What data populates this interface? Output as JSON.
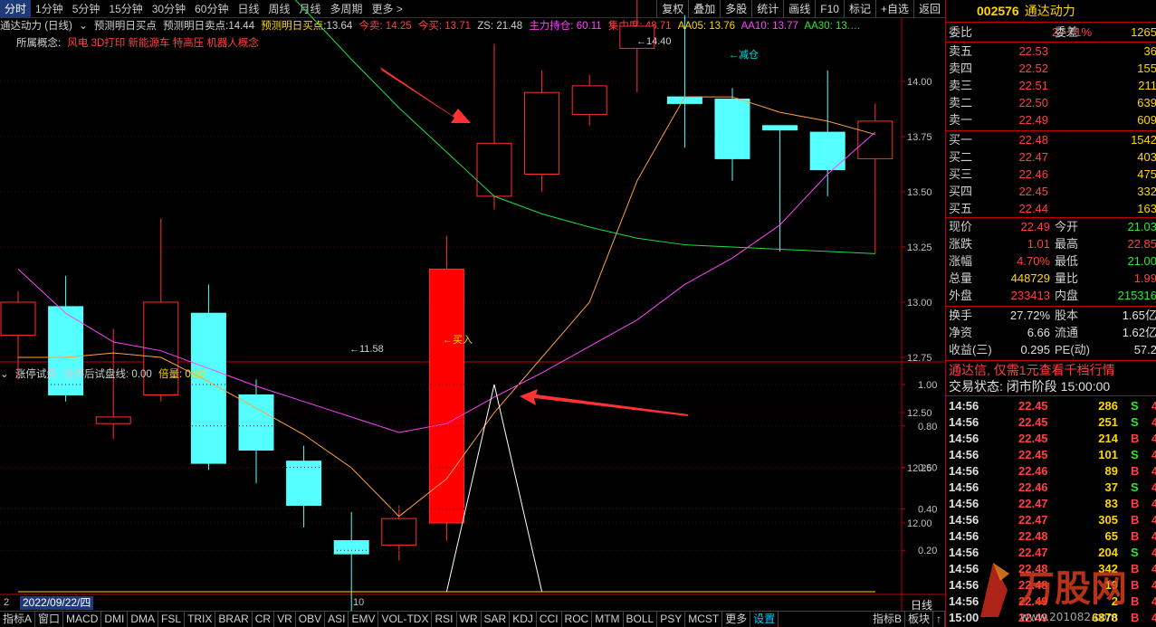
{
  "toolbar": {
    "periods": [
      "分时",
      "1分钟",
      "5分钟",
      "15分钟",
      "30分钟",
      "60分钟",
      "日线",
      "周线",
      "月线",
      "多周期",
      "更多 >"
    ],
    "active_period": "分时",
    "right_buttons": [
      "复权",
      "叠加",
      "多股",
      "统计",
      "画线",
      "F10",
      "标记",
      "+自选",
      "返回"
    ]
  },
  "main_info": {
    "name": "通达动力 (日线)",
    "indicator": "预测明日买点",
    "sell_label": "预测明日卖点:",
    "sell_val": "14.44",
    "buy_label": "预测明日买点:",
    "buy_val": "13.64",
    "jin_mai": "今卖: 14.25",
    "jin_mai2": "今买: 13.71",
    "zs": "ZS: 21.48",
    "zhuli": "主力持仓: 60.11",
    "jizhong": "集中度: 48.71",
    "aa05": "AA05: 13.76",
    "aa10": "AA10: 13.77",
    "aa30": "AA30: 13.…",
    "concept_label": "所属概念:",
    "concepts": "风电 3D打印 新能源车 特高压 机器人概念"
  },
  "annotations": {
    "high": "←14.40",
    "low": "←11.58",
    "buy": "←买入",
    "reduce": "←减仓"
  },
  "price_axis": [
    "14.00",
    "13.75",
    "13.50",
    "13.25",
    "13.00",
    "12.75",
    "12.50",
    "12.25",
    "12.00"
  ],
  "sub_info": {
    "name": "涨停试盘",
    "line_label": "涨停后试盘线: 0.00",
    "multiplier": "倍量: 0.00"
  },
  "sub_axis": [
    "1.00",
    "0.80",
    "0.60",
    "0.40",
    "0.20"
  ],
  "date_axis": {
    "left_date": "2022/09/22/四",
    "left_stub": "2",
    "tick10": "10",
    "period_label": "日线"
  },
  "chart_data": {
    "type": "candlestick",
    "candles": [
      {
        "o": 12.85,
        "h": 13.05,
        "l": 12.65,
        "c": 13.0
      },
      {
        "o": 12.98,
        "h": 13.12,
        "l": 12.55,
        "c": 12.58
      },
      {
        "o": 12.45,
        "h": 12.88,
        "l": 12.38,
        "c": 12.48
      },
      {
        "o": 12.58,
        "h": 13.38,
        "l": 12.55,
        "c": 13.0
      },
      {
        "o": 12.95,
        "h": 13.08,
        "l": 12.24,
        "c": 12.27
      },
      {
        "o": 12.58,
        "h": 12.65,
        "l": 12.18,
        "c": 12.33
      },
      {
        "o": 12.28,
        "h": 12.35,
        "l": 11.98,
        "c": 12.08
      },
      {
        "o": 11.92,
        "h": 12.05,
        "l": 11.58,
        "c": 11.86
      },
      {
        "o": 11.9,
        "h": 12.08,
        "l": 11.83,
        "c": 12.02
      },
      {
        "o": 12.0,
        "h": 13.3,
        "l": 11.92,
        "c": 13.15
      },
      {
        "o": 13.48,
        "h": 14.17,
        "l": 13.42,
        "c": 13.72
      },
      {
        "o": 13.58,
        "h": 14.05,
        "l": 13.5,
        "c": 13.95
      },
      {
        "o": 13.85,
        "h": 14.03,
        "l": 13.8,
        "c": 13.98
      },
      {
        "o": 14.15,
        "h": 14.4,
        "l": 13.95,
        "c": 14.25
      },
      {
        "o": 13.93,
        "h": 14.3,
        "l": 13.7,
        "c": 13.9
      },
      {
        "o": 13.92,
        "h": 13.97,
        "l": 13.55,
        "c": 13.65
      },
      {
        "o": 13.8,
        "h": 13.8,
        "l": 13.23,
        "c": 13.78
      },
      {
        "o": 13.77,
        "h": 14.05,
        "l": 13.48,
        "c": 13.6
      },
      {
        "o": 13.65,
        "h": 13.9,
        "l": 13.22,
        "c": 13.82
      }
    ],
    "ma_short": [
      12.75,
      12.75,
      12.77,
      12.75,
      12.64,
      12.52,
      12.4,
      12.25,
      12.03,
      12.2,
      12.5,
      12.75,
      13.0,
      13.55,
      13.93,
      13.93,
      13.86,
      13.82,
      13.76
    ],
    "ma_mid": [
      13.15,
      12.95,
      12.82,
      12.78,
      12.7,
      12.62,
      12.55,
      12.48,
      12.41,
      12.45,
      12.57,
      12.68,
      12.8,
      12.92,
      13.08,
      13.2,
      13.35,
      13.58,
      13.77
    ],
    "ma_long_start_index": 5,
    "ma_long": [
      14.55,
      14.33,
      14.1,
      13.88,
      13.68,
      13.48,
      13.4,
      13.34,
      13.29,
      13.26,
      13.25,
      13.24,
      13.23,
      13.22
    ],
    "ylim": [
      11.5,
      14.5
    ],
    "sub_series": [
      0,
      0,
      0,
      0,
      0,
      0,
      0,
      0,
      0,
      0,
      1,
      0,
      0,
      0,
      0,
      0,
      0,
      0,
      0
    ],
    "sub_ylim": [
      0,
      1.0
    ]
  },
  "right_panel": {
    "code": "002576",
    "name": "通达动力",
    "weibi_label": "委比",
    "weibi": "27.71%",
    "weicha_label": "委差",
    "weicha": "1265",
    "asks": [
      {
        "label": "卖五",
        "price": "22.53",
        "vol": "36"
      },
      {
        "label": "卖四",
        "price": "22.52",
        "vol": "155"
      },
      {
        "label": "卖三",
        "price": "22.51",
        "vol": "211"
      },
      {
        "label": "卖二",
        "price": "22.50",
        "vol": "639"
      },
      {
        "label": "卖一",
        "price": "22.49",
        "vol": "609"
      }
    ],
    "bids": [
      {
        "label": "买一",
        "price": "22.48",
        "vol": "1542"
      },
      {
        "label": "买二",
        "price": "22.47",
        "vol": "403"
      },
      {
        "label": "买三",
        "price": "22.46",
        "vol": "475"
      },
      {
        "label": "买四",
        "price": "22.45",
        "vol": "332"
      },
      {
        "label": "买五",
        "price": "22.44",
        "vol": "163"
      }
    ],
    "quote": [
      {
        "l1": "现价",
        "v1": "22.49",
        "c1": "#ff4040",
        "l2": "今开",
        "v2": "21.03",
        "c2": "#2ee82e"
      },
      {
        "l1": "涨跌",
        "v1": "1.01",
        "c1": "#ff4040",
        "l2": "最高",
        "v2": "22.85",
        "c2": "#ff4040"
      },
      {
        "l1": "涨幅",
        "v1": "4.70%",
        "c1": "#ff4040",
        "l2": "最低",
        "v2": "21.00",
        "c2": "#2ee82e"
      },
      {
        "l1": "总量",
        "v1": "448729",
        "c1": "#ffd700",
        "l2": "量比",
        "v2": "1.99",
        "c2": "#ff4040"
      },
      {
        "l1": "外盘",
        "v1": "233413",
        "c1": "#ff4040",
        "l2": "内盘",
        "v2": "215316",
        "c2": "#2ee82e"
      }
    ],
    "fund": [
      {
        "l1": "换手",
        "v1": "27.72%",
        "l2": "股本",
        "v2": "1.65亿"
      },
      {
        "l1": "净资",
        "v1": "6.66",
        "l2": "流通",
        "v2": "1.62亿"
      },
      {
        "l1": "收益(三)",
        "v1": "0.295",
        "l2": "PE(动)",
        "v2": "57.2"
      }
    ],
    "ad": "通达信, 仅需1元查看千档行情",
    "status": "交易状态: 闭市阶段 15:00:00",
    "ticks": [
      {
        "t": "14:56",
        "p": "22.45",
        "q": "286",
        "s": "S"
      },
      {
        "t": "14:56",
        "p": "22.45",
        "q": "251",
        "s": "S"
      },
      {
        "t": "14:56",
        "p": "22.45",
        "q": "214",
        "s": "B"
      },
      {
        "t": "14:56",
        "p": "22.45",
        "q": "101",
        "s": "S"
      },
      {
        "t": "14:56",
        "p": "22.46",
        "q": "89",
        "s": "B"
      },
      {
        "t": "14:56",
        "p": "22.46",
        "q": "37",
        "s": "S"
      },
      {
        "t": "14:56",
        "p": "22.47",
        "q": "83",
        "s": "B"
      },
      {
        "t": "14:56",
        "p": "22.47",
        "q": "305",
        "s": "B"
      },
      {
        "t": "14:56",
        "p": "22.48",
        "q": "65",
        "s": "B"
      },
      {
        "t": "14:56",
        "p": "22.47",
        "q": "204",
        "s": "S"
      },
      {
        "t": "14:56",
        "p": "22.48",
        "q": "342",
        "s": "B"
      },
      {
        "t": "14:56",
        "p": "22.48",
        "q": "19",
        "s": "B"
      },
      {
        "t": "14:56",
        "p": "22.49",
        "q": "2",
        "s": "B"
      },
      {
        "t": "15:00",
        "p": "22.49",
        "q": "6878",
        "s": "B"
      }
    ]
  },
  "bottom_tabs": [
    "指标A",
    "窗口",
    "MACD",
    "DMI",
    "DMA",
    "FSL",
    "TRIX",
    "BRAR",
    "CR",
    "VR",
    "OBV",
    "ASI",
    "EMV",
    "VOL-TDX",
    "RSI",
    "WR",
    "SAR",
    "KDJ",
    "CCI",
    "ROC",
    "MTM",
    "BOLL",
    "PSY",
    "MCST",
    "更多",
    "设置"
  ],
  "bottom_right_tabs": [
    "指标B",
    "板块",
    "↑"
  ],
  "watermark": "万股网",
  "watermark_url": "www.201082.com"
}
